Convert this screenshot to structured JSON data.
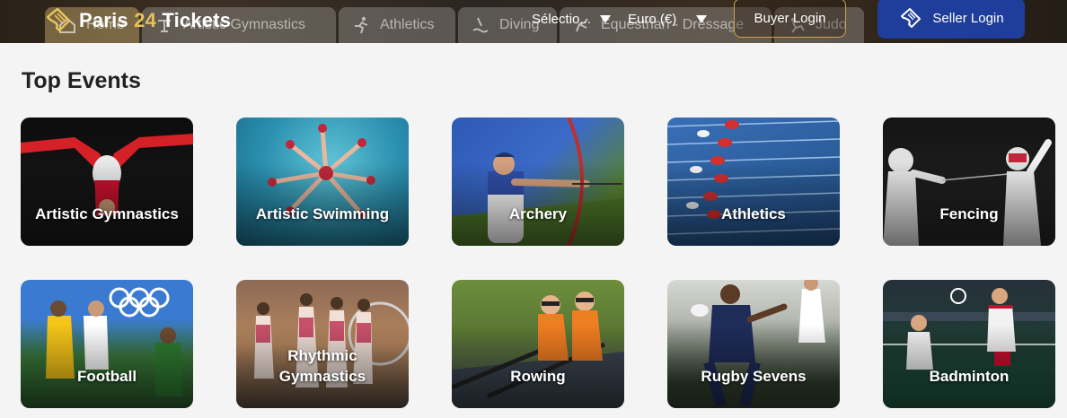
{
  "header": {
    "logo": {
      "prefix": "Paris ",
      "number": "24",
      "suffix": " Tickets"
    },
    "language_select": "Sélectio...",
    "currency_select": "Euro (€)",
    "buyer_login": "Buyer Login",
    "seller_login": "Seller Login",
    "sport_tabs": [
      {
        "label": "Home",
        "icon": "home-icon"
      },
      {
        "label": "Artistic Gymnastics",
        "icon": "gymnastics-icon"
      },
      {
        "label": "Athletics",
        "icon": "runner-icon"
      },
      {
        "label": "Diving",
        "icon": "diver-icon"
      },
      {
        "label": "Equestrian - Dressage",
        "icon": "horse-icon"
      },
      {
        "label": "Judo",
        "icon": "judo-icon"
      }
    ]
  },
  "top_events": {
    "title": "Top Events",
    "cards": [
      {
        "label": "Artistic Gymnastics"
      },
      {
        "label": "Artistic Swimming"
      },
      {
        "label": "Archery"
      },
      {
        "label": "Athletics"
      },
      {
        "label": "Fencing"
      },
      {
        "label": "Football"
      },
      {
        "label": "Rhythmic Gymnastics"
      },
      {
        "label": "Rowing"
      },
      {
        "label": "Rugby Sevens"
      },
      {
        "label": "Badminton"
      }
    ]
  },
  "colors": {
    "header_bg": "#1c1c1c",
    "logo_accent": "#e8c15a",
    "buyer_border": "#c9a44d",
    "seller_bg": "#1f3d9a",
    "page_bg": "#f4f4f4"
  }
}
